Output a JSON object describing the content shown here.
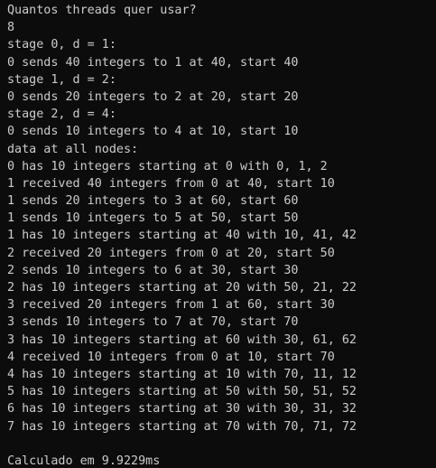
{
  "terminal": {
    "lines": [
      "Quantos threads quer usar?",
      "8",
      "stage 0, d = 1:",
      "0 sends 40 integers to 1 at 40, start 40",
      "stage 1, d = 2:",
      "0 sends 20 integers to 2 at 20, start 20",
      "stage 2, d = 4:",
      "0 sends 10 integers to 4 at 10, start 10",
      "data at all nodes:",
      "0 has 10 integers starting at 0 with 0, 1, 2",
      "1 received 40 integers from 0 at 40, start 10",
      "1 sends 20 integers to 3 at 60, start 60",
      "1 sends 10 integers to 5 at 50, start 50",
      "1 has 10 integers starting at 40 with 10, 41, 42",
      "2 received 20 integers from 0 at 20, start 50",
      "2 sends 10 integers to 6 at 30, start 30",
      "2 has 10 integers starting at 20 with 50, 21, 22",
      "3 received 20 integers from 1 at 60, start 30",
      "3 sends 10 integers to 7 at 70, start 70",
      "3 has 10 integers starting at 60 with 30, 61, 62",
      "4 received 10 integers from 0 at 10, start 70",
      "4 has 10 integers starting at 10 with 70, 11, 12",
      "5 has 10 integers starting at 50 with 50, 51, 52",
      "6 has 10 integers starting at 30 with 30, 31, 32",
      "7 has 10 integers starting at 70 with 70, 71, 72",
      "",
      "Calculado em 9.9229ms"
    ],
    "background_color": "#0c0c0c",
    "text_color": "#cccccc"
  }
}
